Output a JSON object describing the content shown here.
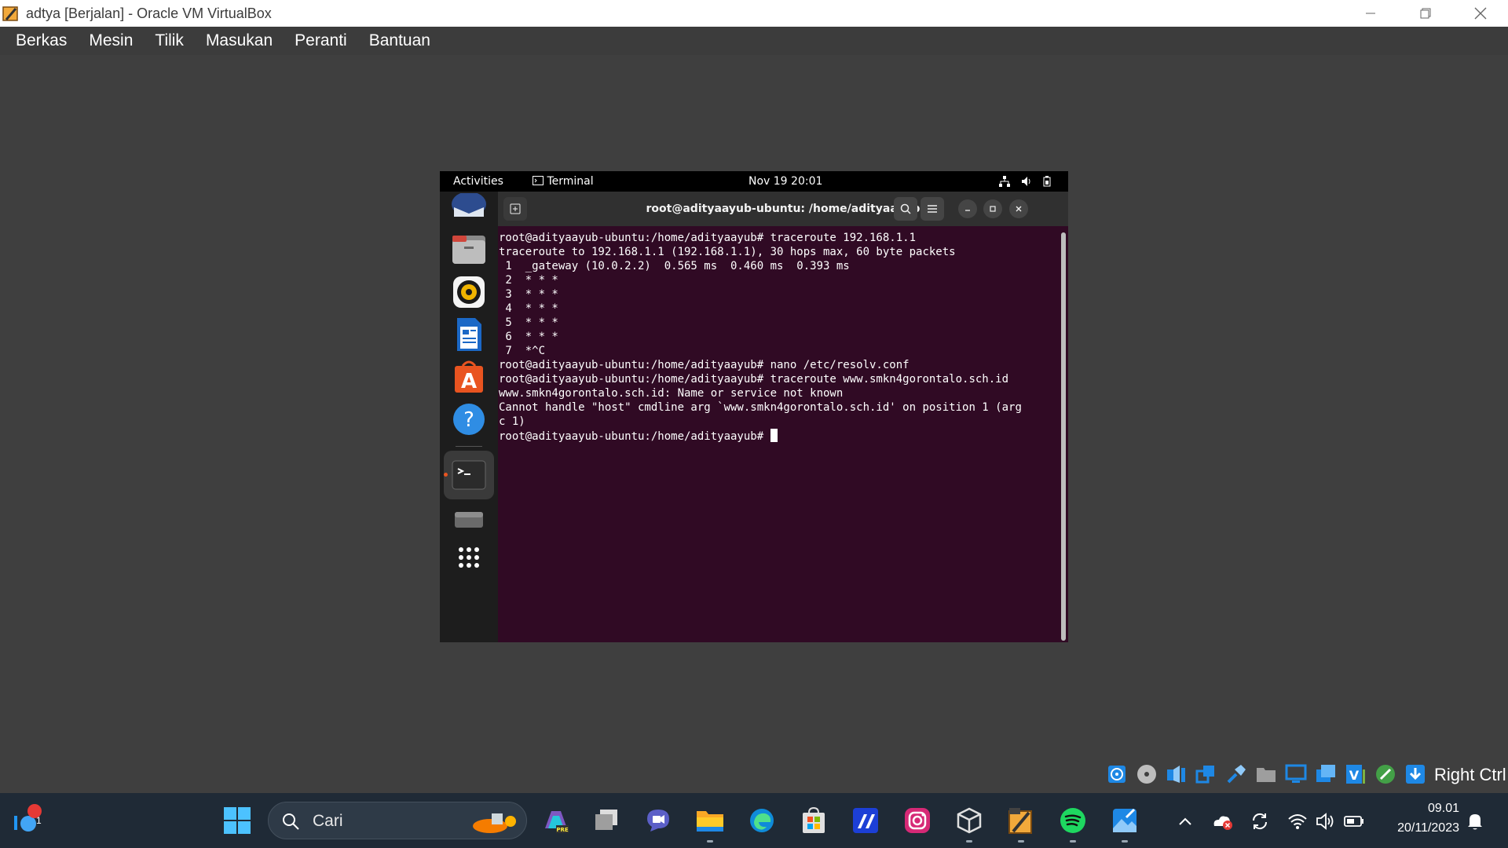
{
  "vbox": {
    "window_title": "adtya [Berjalan] - Oracle VM VirtualBox",
    "menu": [
      "Berkas",
      "Mesin",
      "Tilik",
      "Masukan",
      "Peranti",
      "Bantuan"
    ],
    "host_key_label": "Right Ctrl"
  },
  "guest": {
    "topbar": {
      "activities": "Activities",
      "app_name": "Terminal",
      "clock": "Nov 19  20:01"
    },
    "dock": {
      "items": [
        "thunderbird-icon",
        "files-icon",
        "rhythmbox-icon",
        "writer-icon",
        "app-center-icon",
        "help-icon",
        "terminal-icon",
        "drive-icon",
        "app-grid-icon"
      ]
    },
    "terminal": {
      "title": "root@adityaayub-ubuntu: /home/adityaayub",
      "lines": [
        "root@adityaayub-ubuntu:/home/adityaayub# traceroute 192.168.1.1",
        "traceroute to 192.168.1.1 (192.168.1.1), 30 hops max, 60 byte packets",
        " 1  _gateway (10.0.2.2)  0.565 ms  0.460 ms  0.393 ms",
        " 2  * * *",
        " 3  * * *",
        " 4  * * *",
        " 5  * * *",
        " 6  * * *",
        " 7  *^C",
        "root@adityaayub-ubuntu:/home/adityaayub# nano /etc/resolv.conf",
        "root@adityaayub-ubuntu:/home/adityaayub# traceroute www.smkn4gorontalo.sch.id",
        "www.smkn4gorontalo.sch.id: Name or service not known",
        "Cannot handle \"host\" cmdline arg `www.smkn4gorontalo.sch.id' on position 1 (arg",
        "c 1)"
      ],
      "prompt": "root@adityaayub-ubuntu:/home/adityaayub# "
    }
  },
  "taskbar": {
    "search_placeholder": "Cari",
    "widget_badge": "1",
    "clock_time": "09.01",
    "clock_date": "20/11/2023"
  },
  "colors": {
    "terminal_bg": "#300a24",
    "taskbar_bg": "#1f2a36",
    "vbox_menubar": "#3c3c3c",
    "ubuntu_orange": "#e95420"
  }
}
